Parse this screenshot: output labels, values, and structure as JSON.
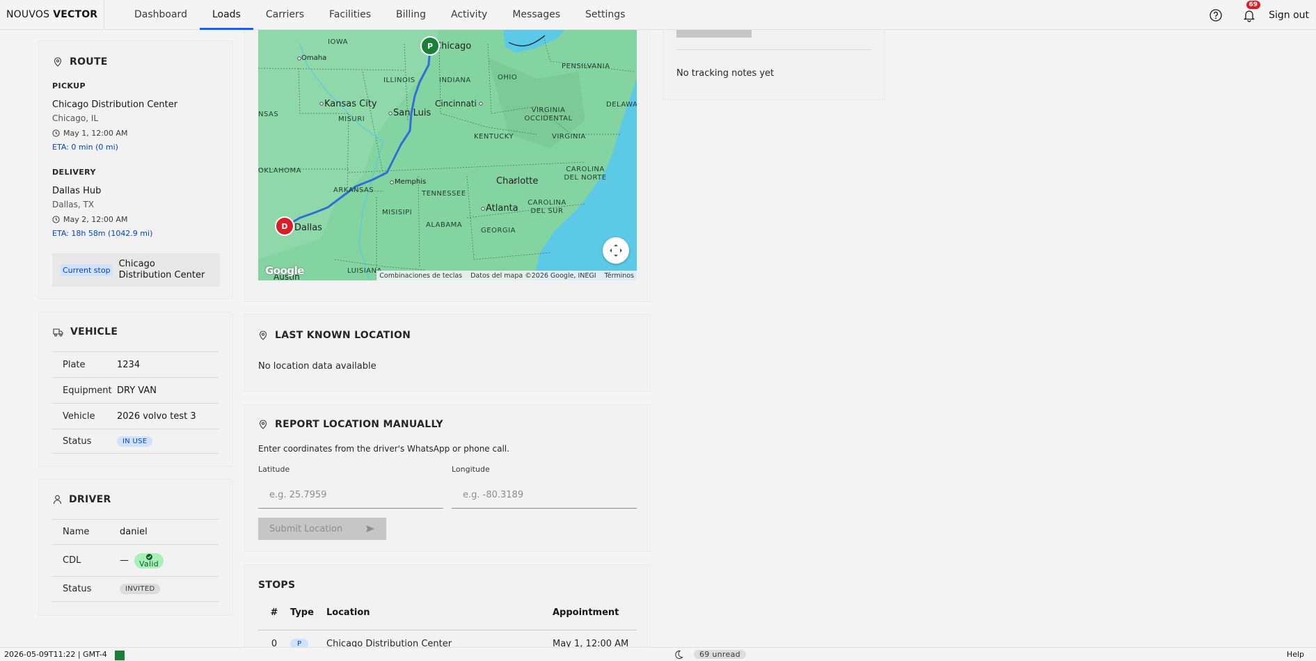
{
  "header": {
    "brand_left": "NOUVOS",
    "brand_right": "VECTOR",
    "nav": [
      "Dashboard",
      "Loads",
      "Carriers",
      "Facilities",
      "Billing",
      "Activity",
      "Messages",
      "Settings"
    ],
    "active_nav": "Loads",
    "notifications_count": "69",
    "signout_label": "Sign out"
  },
  "route": {
    "title": "ROUTE",
    "pickup_heading": "PICKUP",
    "pickup_name": "Chicago Distribution Center",
    "pickup_city": "Chicago, IL",
    "pickup_time": "May 1, 12:00 AM",
    "pickup_eta": "ETA: 0 min (0 mi)",
    "delivery_heading": "DELIVERY",
    "delivery_name": "Dallas Hub",
    "delivery_city": "Dallas, TX",
    "delivery_time": "May 2, 12:00 AM",
    "delivery_eta": "ETA: 18h 58m (1042.9 mi)",
    "current_stop_label": "Current stop",
    "current_stop_value": "Chicago Distribution Center"
  },
  "vehicle": {
    "title": "VEHICLE",
    "rows": [
      {
        "key": "Plate",
        "value": "1234"
      },
      {
        "key": "Equipment",
        "value": "DRY VAN"
      },
      {
        "key": "Vehicle",
        "value": "2026 volvo test 3"
      },
      {
        "key": "Status",
        "value": "IN USE"
      }
    ]
  },
  "driver": {
    "title": "DRIVER",
    "rows": [
      {
        "key": "Name",
        "value": "daniel"
      },
      {
        "key": "CDL",
        "value": "—",
        "badge": "Valid"
      },
      {
        "key": "Status",
        "value": "INVITED"
      }
    ]
  },
  "map": {
    "labels": [
      "IOWA",
      "Omaha",
      "Chicago",
      "ILLINOIS",
      "INDIANA",
      "OHIO",
      "PENSILVANIA",
      "Kansas City",
      "San Luis",
      "Cincinnati",
      "VIRGINIA OCCIDENTAL",
      "DELAWA",
      "NSAS",
      "MISURI",
      "KENTUCKY",
      "VIRGINIA",
      "OKLAHOMA",
      "TENNESSEE",
      "Charlotte",
      "CAROLINA DEL NORTE",
      "Memphis",
      "ARKANSAS",
      "Atlanta",
      "CAROLINA DEL SUR",
      "MISISIPI",
      "ALABAMA",
      "GEORGIA",
      "Dallas",
      "LUISIANA",
      "Austin"
    ],
    "pickup_marker": "P",
    "delivery_marker": "D",
    "footer_keys": "Combinaciones de teclas",
    "footer_data": "Datos del mapa ©2026 Google, INEGI",
    "footer_terms": "Términos",
    "logo_text": "Google"
  },
  "last_known": {
    "title": "LAST KNOWN LOCATION",
    "message": "No location data available"
  },
  "report": {
    "title": "REPORT LOCATION MANUALLY",
    "description": "Enter coordinates from the driver's WhatsApp or phone call.",
    "lat_label": "Latitude",
    "lat_placeholder": "e.g. 25.7959",
    "lng_label": "Longitude",
    "lng_placeholder": "e.g. -80.3189",
    "submit_label": "Submit Location"
  },
  "stops": {
    "title": "STOPS",
    "headers": [
      "#",
      "Type",
      "Location",
      "Appointment"
    ],
    "row": {
      "num": "0",
      "type": "P",
      "location": "Chicago Distribution Center",
      "appointment": "May 1, 12:00 AM"
    }
  },
  "tracking": {
    "message": "No tracking notes yet"
  },
  "status_bar": {
    "timestamp": "2026-05-09T11:22 | GMT-4",
    "unread": "69 unread",
    "help": "Help"
  },
  "colors": {
    "accent": "#0f62fe",
    "pickup_marker": "#198038",
    "delivery_marker": "#da1e28",
    "route_line": "#4a90e2",
    "land": "#7fcf9e",
    "water": "#5cc9e6"
  }
}
